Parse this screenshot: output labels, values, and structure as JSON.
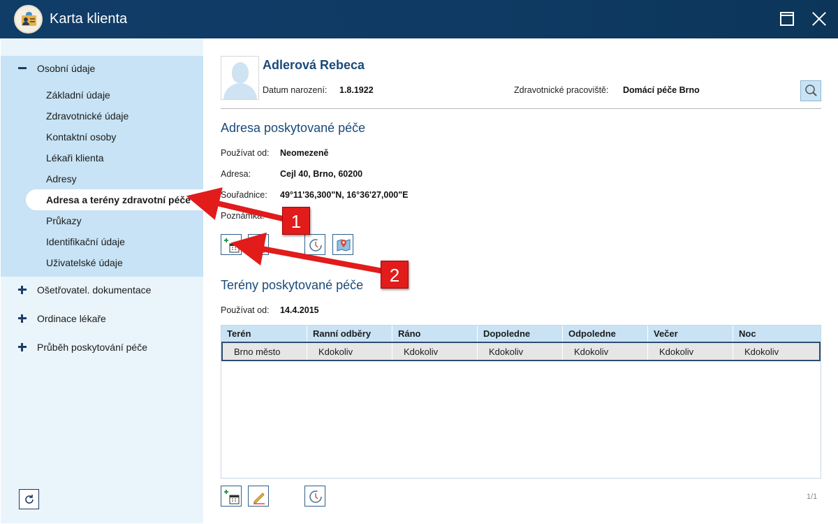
{
  "window": {
    "title": "Karta klienta"
  },
  "sidebar": {
    "groups": [
      {
        "label": "Osobní údaje",
        "expanded": true,
        "items": [
          {
            "label": "Základní údaje"
          },
          {
            "label": "Zdravotnické údaje"
          },
          {
            "label": "Kontaktní osoby"
          },
          {
            "label": "Lékaři klienta"
          },
          {
            "label": "Adresy"
          },
          {
            "label": "Adresa a terény zdravotní péče",
            "active": true
          },
          {
            "label": "Průkazy"
          },
          {
            "label": "Identifikační údaje"
          },
          {
            "label": "Uživatelské údaje"
          }
        ]
      },
      {
        "label": "Ošetřovatel. dokumentace",
        "expanded": false
      },
      {
        "label": "Ordinace lékaře",
        "expanded": false
      },
      {
        "label": "Průběh poskytování péče",
        "expanded": false
      }
    ]
  },
  "client": {
    "name": "Adlerová Rebeca",
    "dob_label": "Datum narození:",
    "dob": "1.8.1922",
    "workplace_label": "Zdravotnické pracoviště:",
    "workplace": "Domácí péče Brno"
  },
  "address_section": {
    "title": "Adresa poskytované péče",
    "valid_from_label": "Používat od:",
    "valid_from": "Neomezeně",
    "address_label": "Adresa:",
    "address": "Cejl 40, Brno, 60200",
    "coords_label": "Souřadnice:",
    "coords": "49°11'36,300\"N, 16°36'27,000\"E",
    "note_label": "Poznámka:"
  },
  "terrain_section": {
    "title": "Terény poskytované péče",
    "valid_from_label": "Používat od:",
    "valid_from": "14.4.2015",
    "columns": [
      "Terén",
      "Ranní odběry",
      "Ráno",
      "Dopoledne",
      "Odpoledne",
      "Večer",
      "Noc"
    ],
    "rows": [
      [
        "Brno město",
        "Kdokoliv",
        "Kdokoliv",
        "Kdokoliv",
        "Kdokoliv",
        "Kdokoliv",
        "Kdokoliv"
      ]
    ],
    "pager": "1/1"
  },
  "annotations": {
    "callout_1": "1",
    "callout_2": "2",
    "color": "#e21b1b"
  },
  "icons": {
    "app": "id-card-icon",
    "maximize": "maximize-icon",
    "close": "close-icon",
    "search": "magnifier-icon",
    "add": "calendar-add-icon",
    "edit": "pencil-icon",
    "history": "history-clock-icon",
    "map": "map-pin-icon",
    "refresh": "refresh-icon"
  }
}
